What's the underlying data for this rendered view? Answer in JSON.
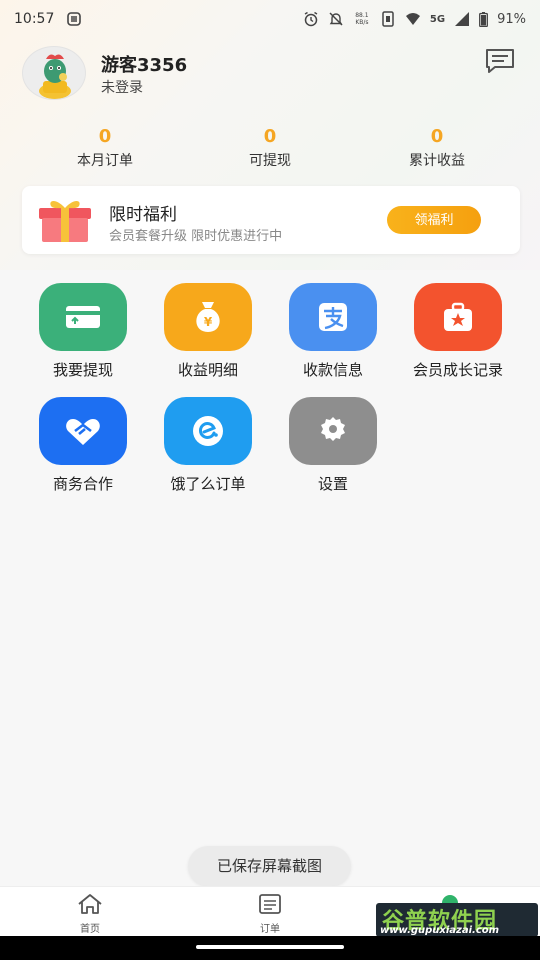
{
  "status_bar": {
    "time": "10:57",
    "network_type": "5G",
    "battery": "91%",
    "net_speed": "88.1 KB/s"
  },
  "profile": {
    "name": "游客3356",
    "login_status": "未登录"
  },
  "stats": [
    {
      "value": "0",
      "label": "本月订单"
    },
    {
      "value": "0",
      "label": "可提现"
    },
    {
      "value": "0",
      "label": "累计收益"
    }
  ],
  "benefit": {
    "title": "限时福利",
    "subtitle": "会员套餐升级 限时优惠进行中",
    "button": "领福利"
  },
  "grid": [
    {
      "label": "我要提现",
      "icon": "card-withdraw-icon",
      "color": "#3bb07a"
    },
    {
      "label": "收益明细",
      "icon": "money-bag-icon",
      "color": "#f7a81b"
    },
    {
      "label": "收款信息",
      "icon": "alipay-icon",
      "color": "#4a90f0"
    },
    {
      "label": "会员成长记录",
      "icon": "star-briefcase-icon",
      "color": "#f3532e"
    },
    {
      "label": "商务合作",
      "icon": "handshake-icon",
      "color": "#1d6ff2"
    },
    {
      "label": "饿了么订单",
      "icon": "eleme-icon",
      "color": "#1f9df0"
    },
    {
      "label": "设置",
      "icon": "gear-icon",
      "color": "#8e8e8e"
    }
  ],
  "toast": "已保存屏幕截图",
  "bottom_nav": [
    {
      "label": "首页",
      "icon": "home-icon"
    },
    {
      "label": "订单",
      "icon": "order-list-icon"
    }
  ],
  "watermark": {
    "main": "谷普软件园",
    "url": "www.gupuxiazai.com"
  }
}
